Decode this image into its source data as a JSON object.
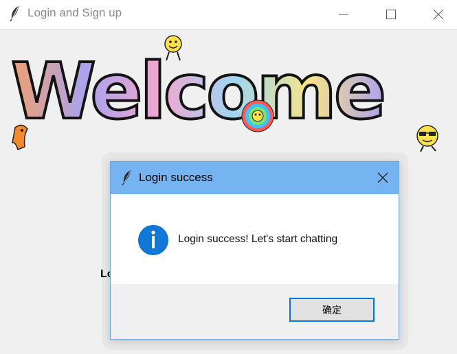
{
  "window": {
    "title": "Login and Sign up",
    "icon": "feather-icon"
  },
  "banner": {
    "text": "Welcome"
  },
  "main": {
    "partial_label": "Lo"
  },
  "dialog": {
    "title": "Login success",
    "icon": "info-icon",
    "message": "Login success! Let's start chatting",
    "ok_label": "确定",
    "titlebar_color": "#75b4f0",
    "accent": "#0078d7"
  }
}
